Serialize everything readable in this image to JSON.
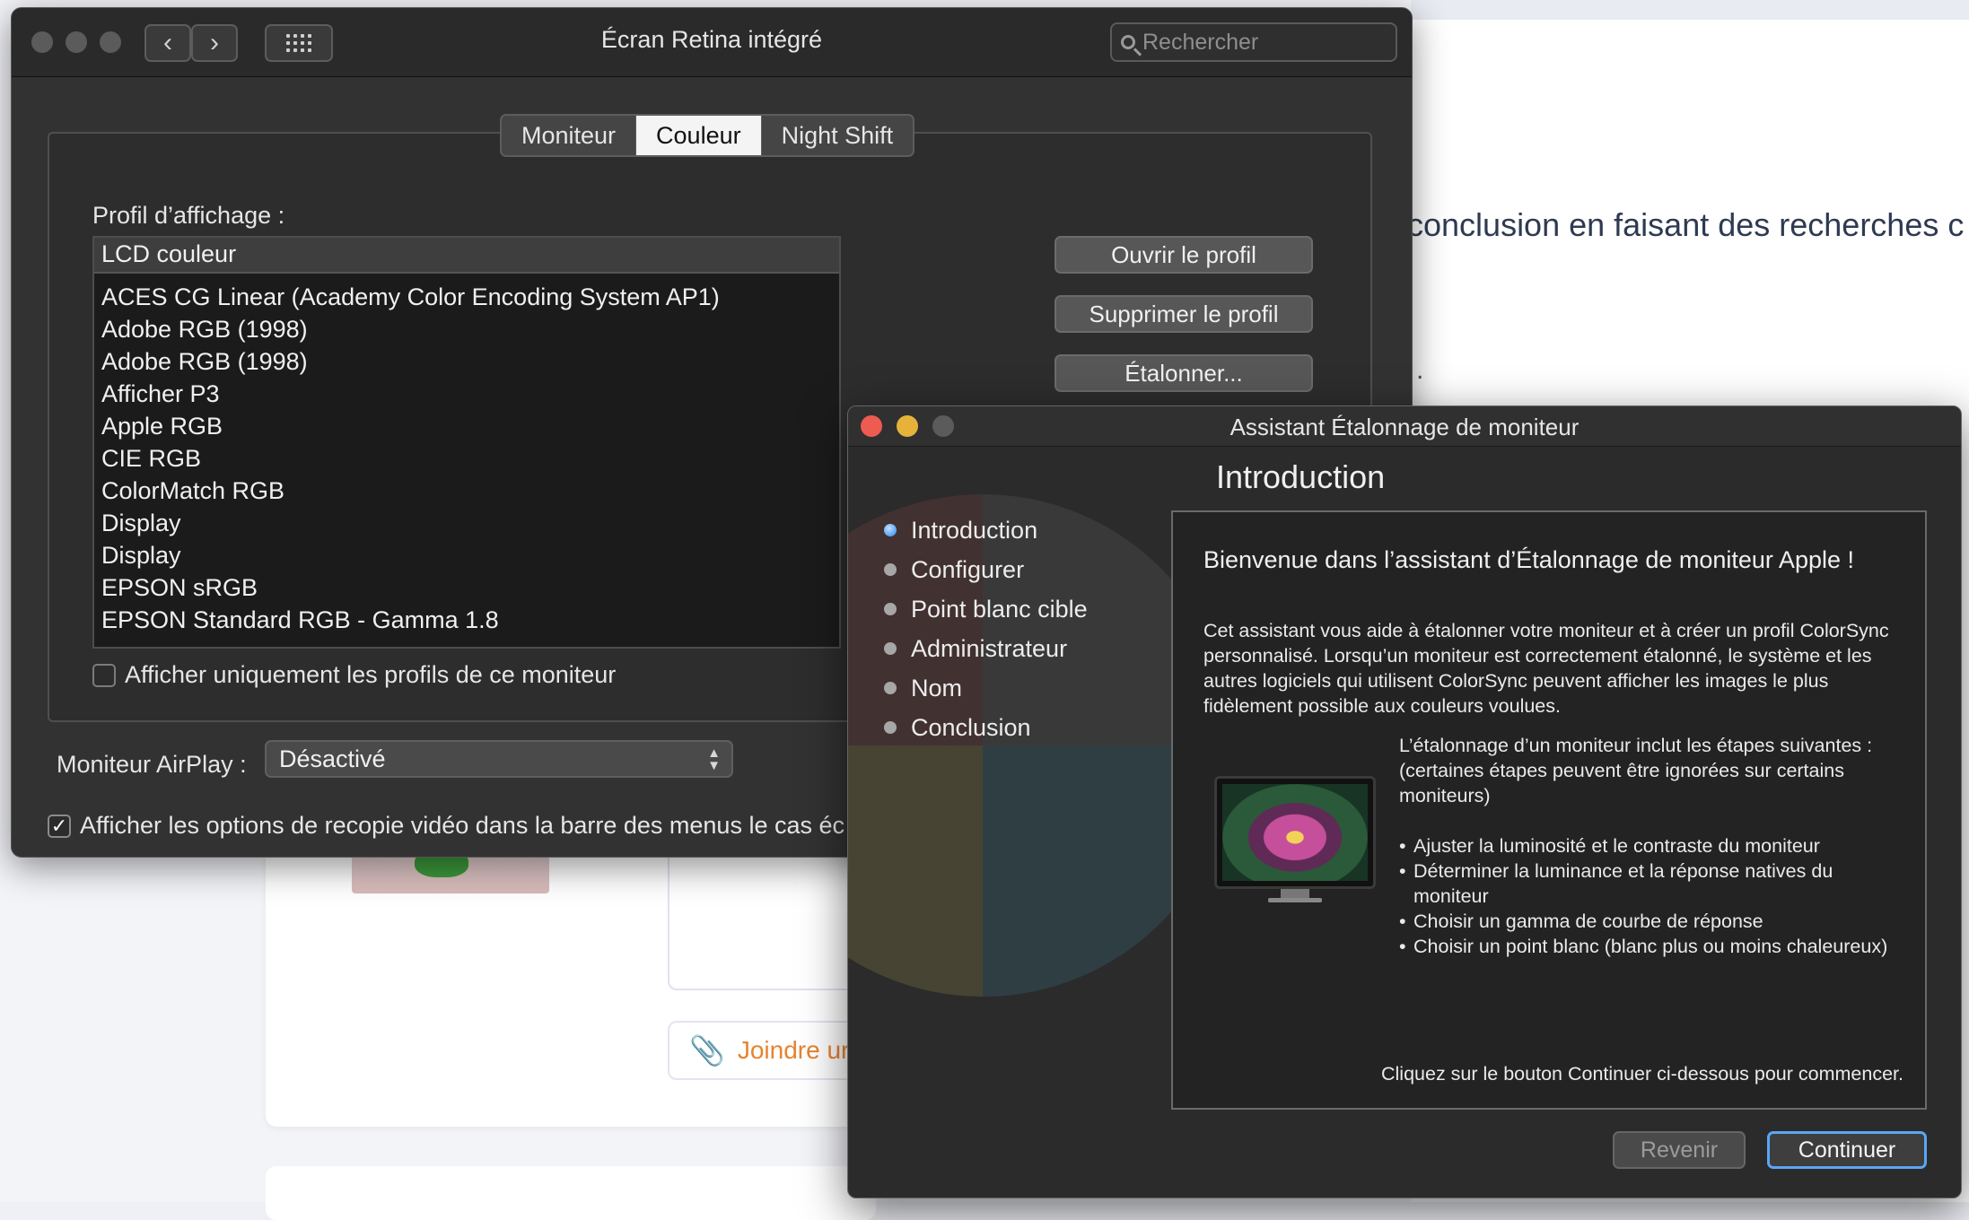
{
  "background_page": {
    "text_fragment": "conclusion en faisant des recherches c",
    "dot": ".",
    "attach_label": "Joindre ur",
    "accent_color": "#e8832e"
  },
  "prefs_window": {
    "title": "Écran Retina intégré",
    "search_placeholder": "Rechercher",
    "tabs": [
      {
        "label": "Moniteur",
        "active": false
      },
      {
        "label": "Couleur",
        "active": true
      },
      {
        "label": "Night Shift",
        "active": false
      }
    ],
    "profile_label": "Profil d’affichage :",
    "profiles": [
      {
        "label": "LCD couleur",
        "selected": true
      },
      {
        "label": "ACES CG Linear (Academy Color Encoding System AP1)"
      },
      {
        "label": "Adobe RGB (1998)"
      },
      {
        "label": "Adobe RGB (1998)"
      },
      {
        "label": "Afficher P3"
      },
      {
        "label": "Apple RGB"
      },
      {
        "label": "CIE RGB"
      },
      {
        "label": "ColorMatch RGB"
      },
      {
        "label": "Display"
      },
      {
        "label": "Display"
      },
      {
        "label": "EPSON  sRGB"
      },
      {
        "label": "EPSON  Standard RGB - Gamma 1.8"
      }
    ],
    "buttons": {
      "open_profile": "Ouvrir le profil",
      "delete_profile": "Supprimer le profil",
      "calibrate": "Étalonner..."
    },
    "only_this_monitor_label": "Afficher uniquement les profils de ce moniteur",
    "only_this_monitor_checked": false,
    "airplay_label": "Moniteur AirPlay :",
    "airplay_value": "Désactivé",
    "mirror_label": "Afficher les options de recopie vidéo dans la barre des menus le cas éc",
    "mirror_checked": true
  },
  "assistant_window": {
    "title": "Assistant Étalonnage de moniteur",
    "heading": "Introduction",
    "steps": [
      {
        "label": "Introduction",
        "active": true
      },
      {
        "label": "Configurer"
      },
      {
        "label": "Point blanc cible"
      },
      {
        "label": "Administrateur"
      },
      {
        "label": "Nom"
      },
      {
        "label": "Conclusion"
      }
    ],
    "welcome": "Bienvenue dans l’assistant d’Étalonnage de moniteur Apple !",
    "paragraph": "Cet assistant vous aide à étalonner votre moniteur et à créer un profil ColorSync personnalisé. Lorsqu’un moniteur est correctement étalonné, le système et les autres logiciels qui utilisent ColorSync peuvent afficher les images le plus fidèlement possible aux couleurs voulues.",
    "steps_intro": "L’étalonnage d’un moniteur inclut les étapes suivantes :",
    "steps_note": "(certaines étapes peuvent être ignorées sur certains moniteurs)",
    "bullets": [
      "Ajuster la luminosité et le contraste du moniteur",
      "Déterminer la luminance et la réponse natives du moniteur",
      "Choisir un gamma de courbe de réponse",
      "Choisir un point blanc (blanc plus ou moins chaleureux)"
    ],
    "call_to_action": "Cliquez sur le bouton Continuer ci-dessous pour commencer.",
    "back_label": "Revenir",
    "continue_label": "Continuer",
    "focus_color": "#5aa6f5"
  }
}
